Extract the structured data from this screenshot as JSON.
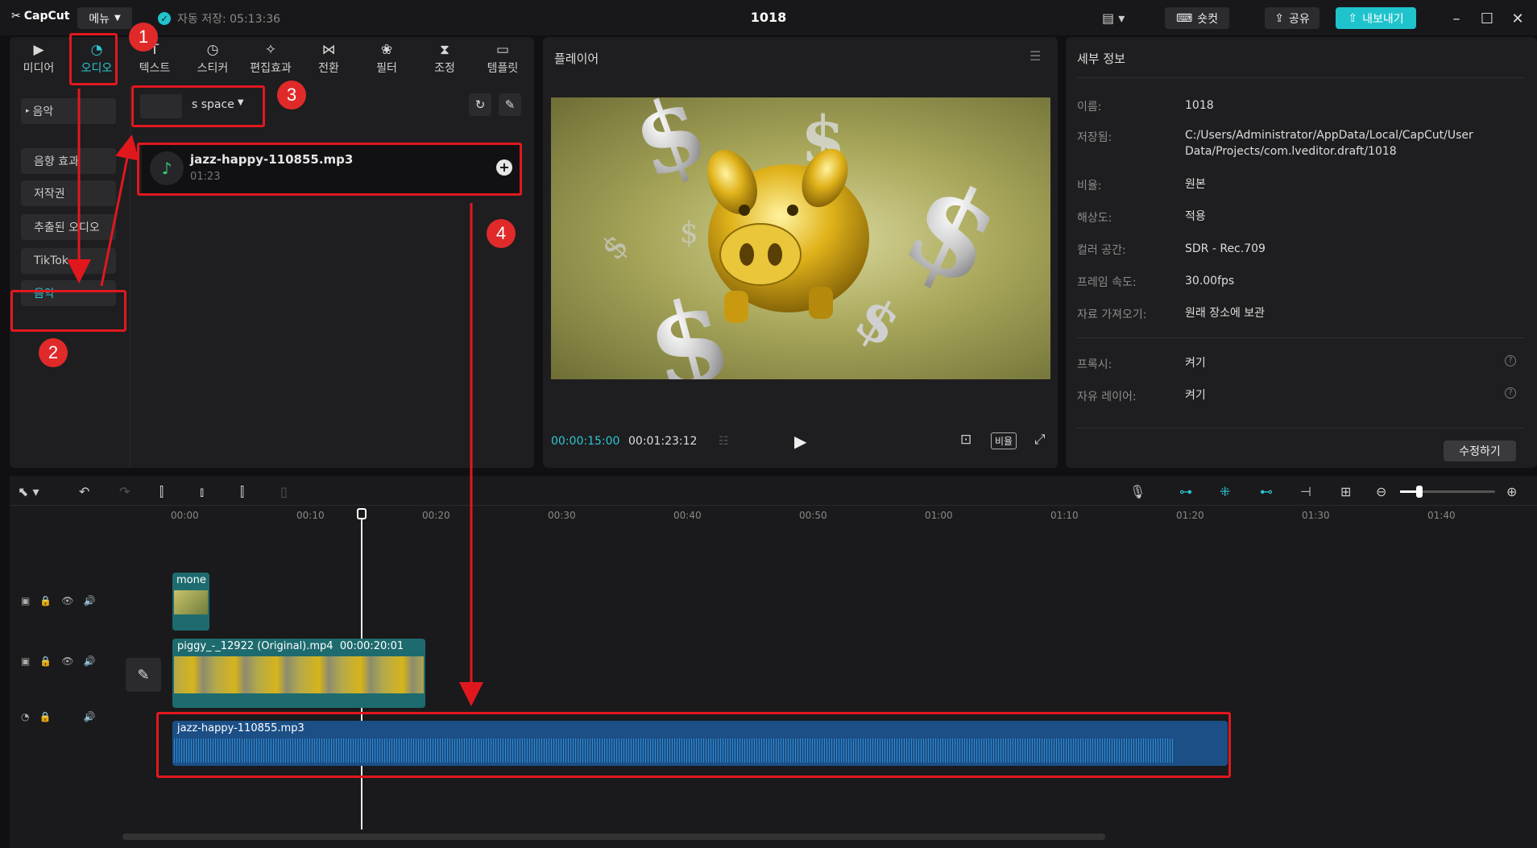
{
  "titlebar": {
    "logo": "CapCut",
    "menu_label": "메뉴",
    "autosave": "자동 저장: 05:13:36",
    "project_name": "1018",
    "shortcuts_label": "숏컷",
    "share_label": "공유",
    "export_label": "내보내기"
  },
  "tabs": [
    {
      "label": "미디어",
      "icon": "media-icon"
    },
    {
      "label": "오디오",
      "icon": "audio-icon"
    },
    {
      "label": "텍스트",
      "icon": "text-icon"
    },
    {
      "label": "스티커",
      "icon": "sticker-icon"
    },
    {
      "label": "편집효과",
      "icon": "effects-icon"
    },
    {
      "label": "전환",
      "icon": "transition-icon"
    },
    {
      "label": "필터",
      "icon": "filter-icon"
    },
    {
      "label": "조정",
      "icon": "adjust-icon"
    },
    {
      "label": "템플릿",
      "icon": "template-icon"
    }
  ],
  "sidebar": {
    "items": [
      {
        "label": "음악"
      },
      {
        "label": "음향 효과"
      },
      {
        "label": "저작권"
      },
      {
        "label": "추출된 오디오"
      },
      {
        "label": "TikTok"
      },
      {
        "label": "음악"
      }
    ]
  },
  "library": {
    "dropdown_label": "s space",
    "audio_item": {
      "name": "jazz-happy-110855.mp3",
      "duration": "01:23"
    }
  },
  "player": {
    "title": "플레이어",
    "current_time": "00:00:15:00",
    "total_time": "00:01:23:12",
    "ratio_label": "비율"
  },
  "details": {
    "title": "세부 정보",
    "rows": [
      {
        "label": "이름:",
        "value": "1018"
      },
      {
        "label": "저장됨:",
        "value": "C:/Users/Administrator/AppData/Local/CapCut/User Data/Projects/com.lveditor.draft/1018"
      },
      {
        "label": "비율:",
        "value": "원본"
      },
      {
        "label": "해상도:",
        "value": "적용"
      },
      {
        "label": "컬러 공간:",
        "value": "SDR - Rec.709"
      },
      {
        "label": "프레임 속도:",
        "value": "30.00fps"
      },
      {
        "label": "자료 가져오기:",
        "value": "원래 장소에 보관"
      },
      {
        "label": "프록시:",
        "value": "켜기"
      },
      {
        "label": "자유 레이어:",
        "value": "켜기"
      }
    ],
    "edit_button": "수정하기"
  },
  "timeline": {
    "ruler": [
      "00:00",
      "00:10",
      "00:20",
      "00:30",
      "00:40",
      "00:50",
      "01:00",
      "01:10",
      "01:20",
      "01:30",
      "01:40"
    ],
    "clips": {
      "overlay": "mone",
      "video": "piggy_-_12922 (Original).mp4",
      "video_duration": "00:00:20:01",
      "audio": "jazz-happy-110855.mp3"
    }
  },
  "annotations": {
    "badges": [
      "1",
      "2",
      "3",
      "4"
    ],
    "colors": {
      "accent": "#2ec6d0",
      "annotation": "#e0181e",
      "video_clip": "#1e6b6f",
      "audio_clip": "#1b4f86"
    }
  }
}
